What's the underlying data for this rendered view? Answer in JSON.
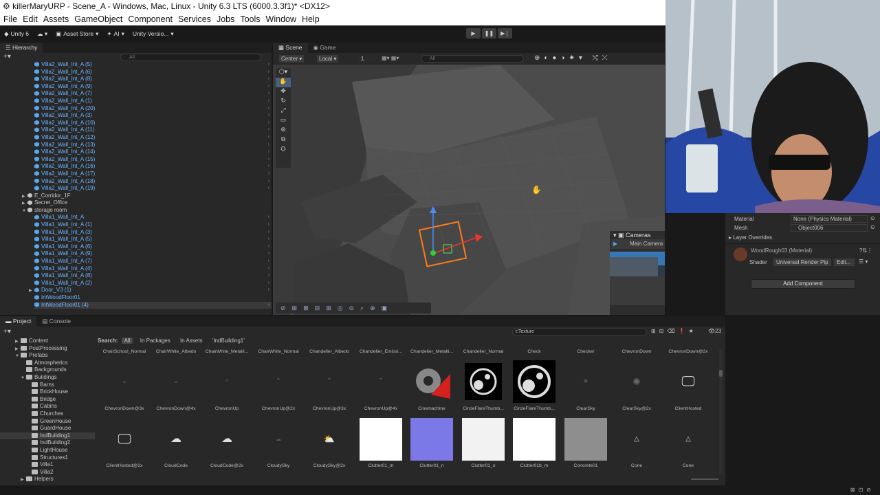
{
  "window": {
    "title": "killerMaryURP - Scene_A - Windows, Mac, Linux - Unity 6.3 LTS (6000.3.3f1)* <DX12>"
  },
  "menu": [
    "File",
    "Edit",
    "Assets",
    "GameObject",
    "Component",
    "Services",
    "Jobs",
    "Tools",
    "Window",
    "Help"
  ],
  "toolbar": {
    "account": "Unity 6",
    "asset_store": "Asset Store",
    "ai": "AI",
    "version_control": "Unity Versio..."
  },
  "hierarchy": {
    "tab": "Hierarchy",
    "search_placeholder": "All",
    "rows_top": [
      "Villa2_Wall_Int_A (5)",
      "Villa2_Wall_Int_A (6)",
      "Villa2_Wall_Int_A (8)",
      "Villa2_Wall_Int_A (9)",
      "Villa2_Wall_Int_A (7)",
      "Villa2_Wall_Int_A (1)",
      "Villa2_Wall_Int_A (20)",
      "Villa2_Wall_Int_A (3)",
      "Villa2_Wall_Int_A (10)",
      "Villa2_Wall_Int_A (11)",
      "Villa2_Wall_Int_A (12)",
      "Villa2_Wall_Int_A (13)",
      "Villa2_Wall_Int_A (14)",
      "Villa2_Wall_Int_A (15)",
      "Villa2_Wall_Int_A (16)",
      "Villa2_Wall_Int_A (17)",
      "Villa2_Wall_Int_A (18)",
      "Villa2_Wall_Int_A (19)"
    ],
    "groups": [
      "E_Corridor_1F",
      "Secret_Office",
      "storage room"
    ],
    "rows_bottom": [
      "Villa1_Wall_Int_A",
      "Villa1_Wall_Int_A (1)",
      "Villa1_Wall_Int_A (3)",
      "Villa1_Wall_Int_A (5)",
      "Villa1_Wall_Int_A (6)",
      "Villa1_Wall_Int_A (9)",
      "Villa1_Wall_Int_A (7)",
      "Villa1_Wall_Int_A (4)",
      "Villa1_Wall_Int_A (8)",
      "Villa1_Wall_Int_A (2)",
      "Door_V3 (1)",
      "IntWoodFloor01",
      "IntWoodFloor01 (4)"
    ]
  },
  "scene": {
    "tab_scene": "Scene",
    "tab_game": "Game",
    "pivot": "Center",
    "space": "Local",
    "grid_value": "1",
    "search_placeholder": "All",
    "cameras_title": "Cameras",
    "camera_select": "Main Camera"
  },
  "inspector": {
    "material_label": "Material",
    "material_value": "None (Physics Material)",
    "mesh_label": "Mesh",
    "mesh_value": "Object006",
    "layer_overrides": "Layer Overrides",
    "mat_name": "WoodRough03 (Material)",
    "shader_label": "Shader",
    "shader_value": "Universal Render Pip",
    "edit_btn": "Edit...",
    "add_component": "Add Component"
  },
  "project": {
    "tab_project": "Project",
    "tab_console": "Console",
    "search_value": "t:Texture",
    "count": "23",
    "search_label": "Search:",
    "filter_all": "All",
    "filter_packages": "In Packages",
    "filter_assets": "In Assets",
    "filter_folder": "'IndBuilding1'",
    "tree": [
      "Content",
      "PostProcessing",
      "Prefabs",
      "Atmospherics",
      "Backgrounds",
      "Buildings",
      "Barns",
      "BrickHouse",
      "Bridge",
      "Cabins",
      "Churches",
      "GreenHouse",
      "GuardHouse",
      "IndBuilding1",
      "IndBuilding2",
      "LightHouse",
      "Structures1",
      "Villa1",
      "Villa2",
      "Helpers"
    ],
    "row0": [
      "ChairSchool_Normal",
      "ChairWhite_Albedo",
      "ChairWhite_Metalli...",
      "ChairWhite_Normal",
      "Chandelier_Albedo",
      "Chandelier_Emissi...",
      "Chandelier_Metalli...",
      "Chandelier_Normal",
      "Check",
      "Checker",
      "ChevronDown",
      "ChevronDown@2x"
    ],
    "row1": [
      "ChevronDown@3x",
      "ChevronDown@4x",
      "ChevronUp",
      "ChevronUp@2x",
      "ChevronUp@3x",
      "ChevronUp@4x",
      "Cinemachine",
      "CircleFlareThumb...",
      "CircleFlareThumb...",
      "ClearSky",
      "ClearSky@2x",
      "ClientHosted"
    ],
    "row2": [
      "ClientHosted@2x",
      "CloudCode",
      "CloudCode@2x",
      "CloudySky",
      "CloudySky@2x",
      "Clutter01_m",
      "Clutter01_n",
      "Clutter01_o",
      "Clutter01b_m",
      "Concrete01",
      "Cone",
      "Cone"
    ]
  }
}
